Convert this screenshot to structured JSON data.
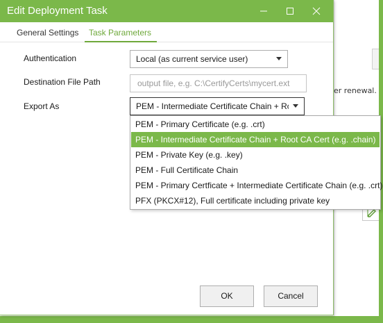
{
  "window": {
    "title": "Edit Deployment Task",
    "controls": {
      "minimize": "minimize-icon",
      "maximize": "maximize-icon",
      "close": "close-icon"
    }
  },
  "tabs": [
    {
      "label": "General Settings",
      "active": false
    },
    {
      "label": "Task Parameters",
      "active": true
    }
  ],
  "form": {
    "authentication": {
      "label": "Authentication",
      "value": "Local (as current service user)"
    },
    "destination": {
      "label": "Destination File Path",
      "value": "",
      "placeholder": "output file, e.g. C:\\CertifyCerts\\mycert.ext"
    },
    "export_as": {
      "label": "Export As",
      "value": "PEM - Intermediate Certificate Chain + Root CA Cert (e.g. .chain)"
    }
  },
  "dropdown": {
    "options": [
      "PEM - Primary Certificate (e.g. .crt)",
      "PEM - Intermediate Certificate Chain + Root CA Cert (e.g. .chain)",
      "PEM - Private Key (e.g. .key)",
      "PEM - Full Certificate Chain",
      "PEM - Primary Certficate + Intermediate Certificate Chain (e.g. .crt)",
      "PFX (PKCX#12), Full certificate including private key"
    ],
    "selected_index": 1
  },
  "buttons": {
    "ok": "OK",
    "cancel": "Cancel"
  },
  "background": {
    "partial_text": "er renewal."
  },
  "colors": {
    "accent": "#7bb84a",
    "tab_active": "#6ea83a"
  }
}
